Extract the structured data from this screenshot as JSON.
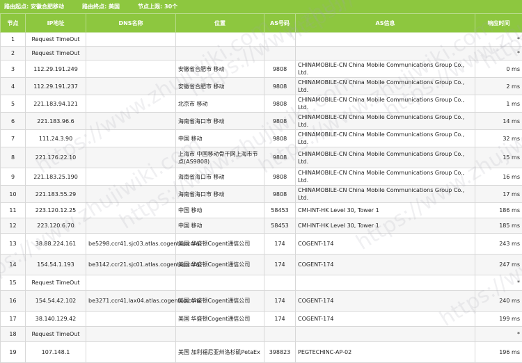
{
  "header": {
    "start_label": "路由起点:",
    "start_value": "安徽合肥移动",
    "end_label": "路由终点:",
    "end_value": "美国",
    "hops_label": "节点上限:",
    "hops_value": "30个"
  },
  "columns": [
    "节点",
    "IP地址",
    "DNS名称",
    "位置",
    "AS号码",
    "AS信息",
    "响应时间"
  ],
  "rows": [
    {
      "hop": "1",
      "ip": "Request TimeOut",
      "dns": "",
      "loc": "",
      "as": "",
      "asinfo": "",
      "time": "*",
      "h": 20
    },
    {
      "hop": "2",
      "ip": "Request TimeOut",
      "dns": "",
      "loc": "",
      "as": "",
      "asinfo": "",
      "time": "*",
      "h": 20
    },
    {
      "hop": "3",
      "ip": "112.29.191.249",
      "dns": "",
      "loc": "安徽省合肥市 移动",
      "as": "9808",
      "asinfo": "CHINAMOBILE-CN China Mobile Communications Group Co., Ltd.",
      "time": "0 ms",
      "h": 24
    },
    {
      "hop": "4",
      "ip": "112.29.191.237",
      "dns": "",
      "loc": "安徽省合肥市 移动",
      "as": "9808",
      "asinfo": "CHINAMOBILE-CN China Mobile Communications Group Co., Ltd.",
      "time": "2 ms",
      "h": 22
    },
    {
      "hop": "5",
      "ip": "221.183.94.121",
      "dns": "",
      "loc": "北京市 移动",
      "as": "9808",
      "asinfo": "CHINAMOBILE-CN China Mobile Communications Group Co., Ltd.",
      "time": "1 ms",
      "h": 22
    },
    {
      "hop": "6",
      "ip": "221.183.96.6",
      "dns": "",
      "loc": "海南省海口市 移动",
      "as": "9808",
      "asinfo": "CHINAMOBILE-CN China Mobile Communications Group Co., Ltd.",
      "time": "14 ms",
      "h": 22
    },
    {
      "hop": "7",
      "ip": "111.24.3.90",
      "dns": "",
      "loc": "中国 移动",
      "as": "9808",
      "asinfo": "CHINAMOBILE-CN China Mobile Communications Group Co., Ltd.",
      "time": "32 ms",
      "h": 22
    },
    {
      "hop": "8",
      "ip": "221.176.22.10",
      "dns": "",
      "loc": "上海市 中国移动骨干网上海市节点(AS9808)",
      "as": "9808",
      "asinfo": "CHINAMOBILE-CN China Mobile Communications Group Co., Ltd.",
      "time": "15 ms",
      "h": 30
    },
    {
      "hop": "9",
      "ip": "221.183.25.190",
      "dns": "",
      "loc": "海南省海口市 移动",
      "as": "9808",
      "asinfo": "CHINAMOBILE-CN China Mobile Communications Group Co., Ltd.",
      "time": "16 ms",
      "h": 22
    },
    {
      "hop": "10",
      "ip": "221.183.55.29",
      "dns": "",
      "loc": "海南省海口市 移动",
      "as": "9808",
      "asinfo": "CHINAMOBILE-CN China Mobile Communications Group Co., Ltd.",
      "time": "17 ms",
      "h": 22
    },
    {
      "hop": "11",
      "ip": "223.120.12.25",
      "dns": "",
      "loc": "中国 移动",
      "as": "58453",
      "asinfo": "CMI-INT-HK Level 30, Tower 1",
      "time": "186 ms",
      "h": 22
    },
    {
      "hop": "12",
      "ip": "223.120.6.70",
      "dns": "",
      "loc": "中国 移动",
      "as": "58453",
      "asinfo": "CMI-INT-HK Level 30, Tower 1",
      "time": "185 ms",
      "h": 22
    },
    {
      "hop": "13",
      "ip": "38.88.224.161",
      "dns": "be5298.ccr41.sjc03.atlas.cogentco.com",
      "loc": "美国 华盛顿Cogent通信公司",
      "as": "174",
      "asinfo": "COGENT-174",
      "time": "243 ms",
      "h": 30
    },
    {
      "hop": "14",
      "ip": "154.54.1.193",
      "dns": "be3142.ccr21.sjc01.atlas.cogentco.com",
      "loc": "美国 华盛顿Cogent通信公司",
      "as": "174",
      "asinfo": "COGENT-174",
      "time": "247 ms",
      "h": 30
    },
    {
      "hop": "15",
      "ip": "Request TimeOut",
      "dns": "",
      "loc": "",
      "as": "",
      "asinfo": "",
      "time": "*",
      "h": 22
    },
    {
      "hop": "16",
      "ip": "154.54.42.102",
      "dns": "be3271.ccr41.lax04.atlas.cogentco.com",
      "loc": "美国 华盛顿Cogent通信公司",
      "as": "174",
      "asinfo": "COGENT-174",
      "time": "240 ms",
      "h": 30
    },
    {
      "hop": "17",
      "ip": "38.140.129.42",
      "dns": "",
      "loc": "美国 华盛顿Cogent通信公司",
      "as": "174",
      "asinfo": "COGENT-174",
      "time": "199 ms",
      "h": 22
    },
    {
      "hop": "18",
      "ip": "Request TimeOut",
      "dns": "",
      "loc": "",
      "as": "",
      "asinfo": "",
      "time": "*",
      "h": 22
    },
    {
      "hop": "19",
      "ip": "107.148.1",
      "dns": "",
      "loc": "美国 加利福尼亚州洛杉矶PetaEx",
      "as": "398823",
      "asinfo": "PEGTECHINC-AP-02",
      "time": "196 ms",
      "h": 30
    }
  ],
  "watermark": "https://www.zhujiwiki.com"
}
